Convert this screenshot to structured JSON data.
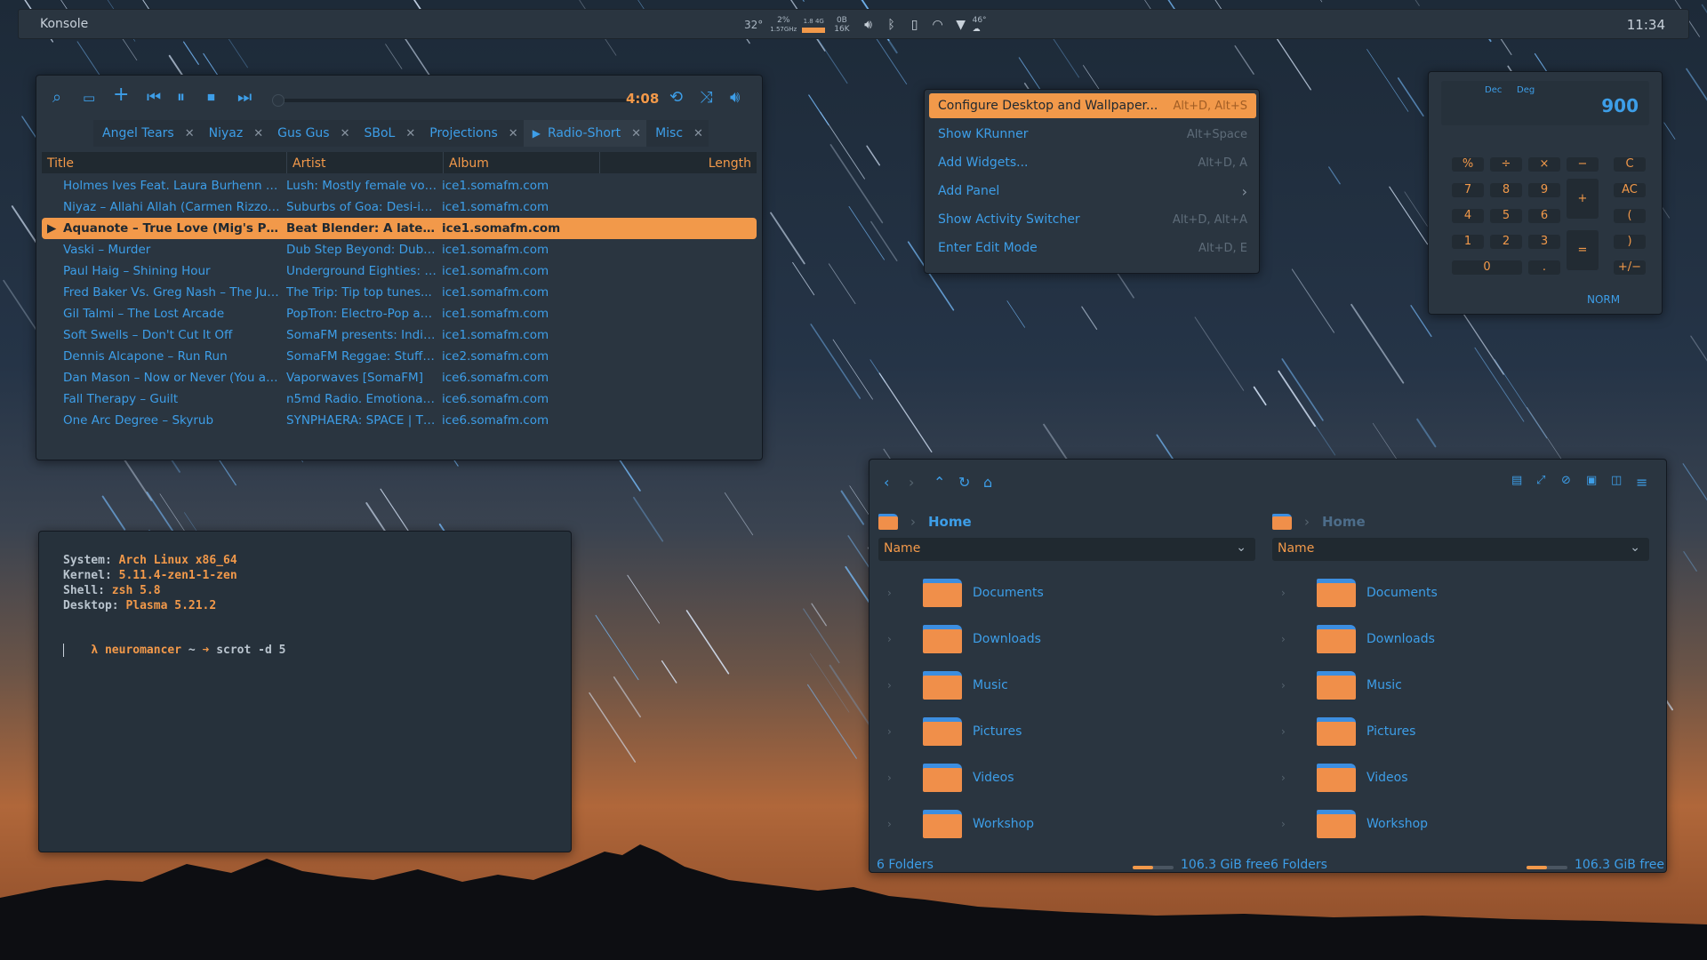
{
  "panel": {
    "title": "Konsole",
    "clock": "11:34",
    "temp": "32°",
    "cpu_pct": "2%",
    "cpu_freq": "1.57GHz",
    "mem": "1.8 4G",
    "net_up": "0B",
    "net_down": "16K",
    "weather": "46°",
    "icons": [
      "volume-icon",
      "bluetooth-icon",
      "phone-icon",
      "wifi-icon",
      "arrow-down-icon",
      "weather-icon"
    ]
  },
  "player": {
    "time": "4:08",
    "tabs": [
      "Angel Tears",
      "Niyaz",
      "Gus Gus",
      "SBoL",
      "Projections",
      "Radio-Short",
      "Misc"
    ],
    "active_tab": "Radio-Short",
    "columns": [
      "Title",
      "Artist",
      "Album",
      "Length"
    ],
    "rows": [
      {
        "title": "Holmes Ives Feat. Laura Burhenn – C...",
        "artist": "Lush: Mostly female voc...",
        "album": "ice1.somafm.com"
      },
      {
        "title": "Niyaz – Allahi Allah (Carmen Rizzo M...",
        "artist": "Suburbs of Goa: Desi-in...",
        "album": "ice1.somafm.com"
      },
      {
        "title": "Aquanote – True Love (Mig's Pet...",
        "artist": "Beat Blender: A late n...",
        "album": "ice1.somafm.com",
        "playing": true
      },
      {
        "title": "Vaski – Murder",
        "artist": "Dub Step Beyond: Dubst...",
        "album": "ice1.somafm.com"
      },
      {
        "title": "Paul Haig – Shining Hour",
        "artist": "Underground Eighties: U...",
        "album": "ice1.somafm.com"
      },
      {
        "title": "Fred Baker Vs. Greg Nash – The Jungl...",
        "artist": "The Trip: Tip top tunes...",
        "album": "ice1.somafm.com"
      },
      {
        "title": "Gil Talmi – The Lost Arcade",
        "artist": "PopTron: Electro-Pop an...",
        "album": "ice1.somafm.com"
      },
      {
        "title": "Soft Swells – Don't Cut It Off",
        "artist": "SomaFM presents: Indie ...",
        "album": "ice1.somafm.com"
      },
      {
        "title": "Dennis Alcapone – Run Run",
        "artist": "SomaFM Reggae: Stuff [S...",
        "album": "ice2.somafm.com"
      },
      {
        "title": "Dan Mason – Now or Never (You and...",
        "artist": "Vaporwaves [SomaFM]",
        "album": "ice6.somafm.com"
      },
      {
        "title": "Fall Therapy – Guilt",
        "artist": "n5md Radio. Emotional ...",
        "album": "ice6.somafm.com"
      },
      {
        "title": "One Arc Degree – Skyrub",
        "artist": "SYNPHAERA: SPACE | Tl...",
        "album": "ice6.somafm.com"
      }
    ]
  },
  "terminal": {
    "lines": [
      {
        "label": "System:",
        "value": " Arch Linux x86_64"
      },
      {
        "label": "Kernel:",
        "value": " 5.11.4-zen1-1-zen"
      },
      {
        "label": "Shell:",
        "value": " zsh 5.8"
      },
      {
        "label": "Desktop:",
        "value": " Plasma 5.21.2"
      }
    ],
    "prompt_symbol": "λ",
    "prompt_host": "neuromancer",
    "prompt_tilde": "~",
    "prompt_arrow": "➜",
    "command": "scrot -d 5"
  },
  "context_menu": {
    "items": [
      {
        "label": "Configure Desktop and Wallpaper...",
        "shortcut": "Alt+D, Alt+S"
      },
      {
        "label": "Show KRunner",
        "shortcut": "Alt+Space"
      },
      {
        "label": "Add Widgets...",
        "shortcut": "Alt+D, A"
      },
      {
        "label": "Add Panel",
        "shortcut": "›"
      },
      {
        "label": "Show Activity Switcher",
        "shortcut": "Alt+D, Alt+A"
      },
      {
        "label": "Enter Edit Mode",
        "shortcut": "Alt+D, E"
      }
    ]
  },
  "calculator": {
    "mode1": "Dec",
    "mode2": "Deg",
    "display": "900",
    "buttons": [
      "%",
      "÷",
      "×",
      "−",
      "C",
      "7",
      "8",
      "9",
      "+",
      "AC",
      "4",
      "5",
      "6",
      "(",
      "1",
      "2",
      "3",
      "=",
      ")",
      "0",
      ".",
      "+/−"
    ],
    "footer": "NORM"
  },
  "file_manager": {
    "panes": [
      {
        "crumb": "Home",
        "column": "Name",
        "folders": [
          "Documents",
          "Downloads",
          "Music",
          "Pictures",
          "Videos",
          "Workshop"
        ],
        "status": "6 Folders",
        "free": "106.3 GiB free",
        "used_fraction": 0.5
      },
      {
        "crumb": "Home",
        "column": "Name",
        "folders": [
          "Documents",
          "Downloads",
          "Music",
          "Pictures",
          "Videos",
          "Workshop"
        ],
        "status": "6 Folders",
        "free": "106.3 GiB free",
        "used_fraction": 0.5
      }
    ]
  },
  "colors": {
    "accent": "#3d9ee8",
    "highlight": "#f2994a",
    "window": "#2a3540"
  }
}
